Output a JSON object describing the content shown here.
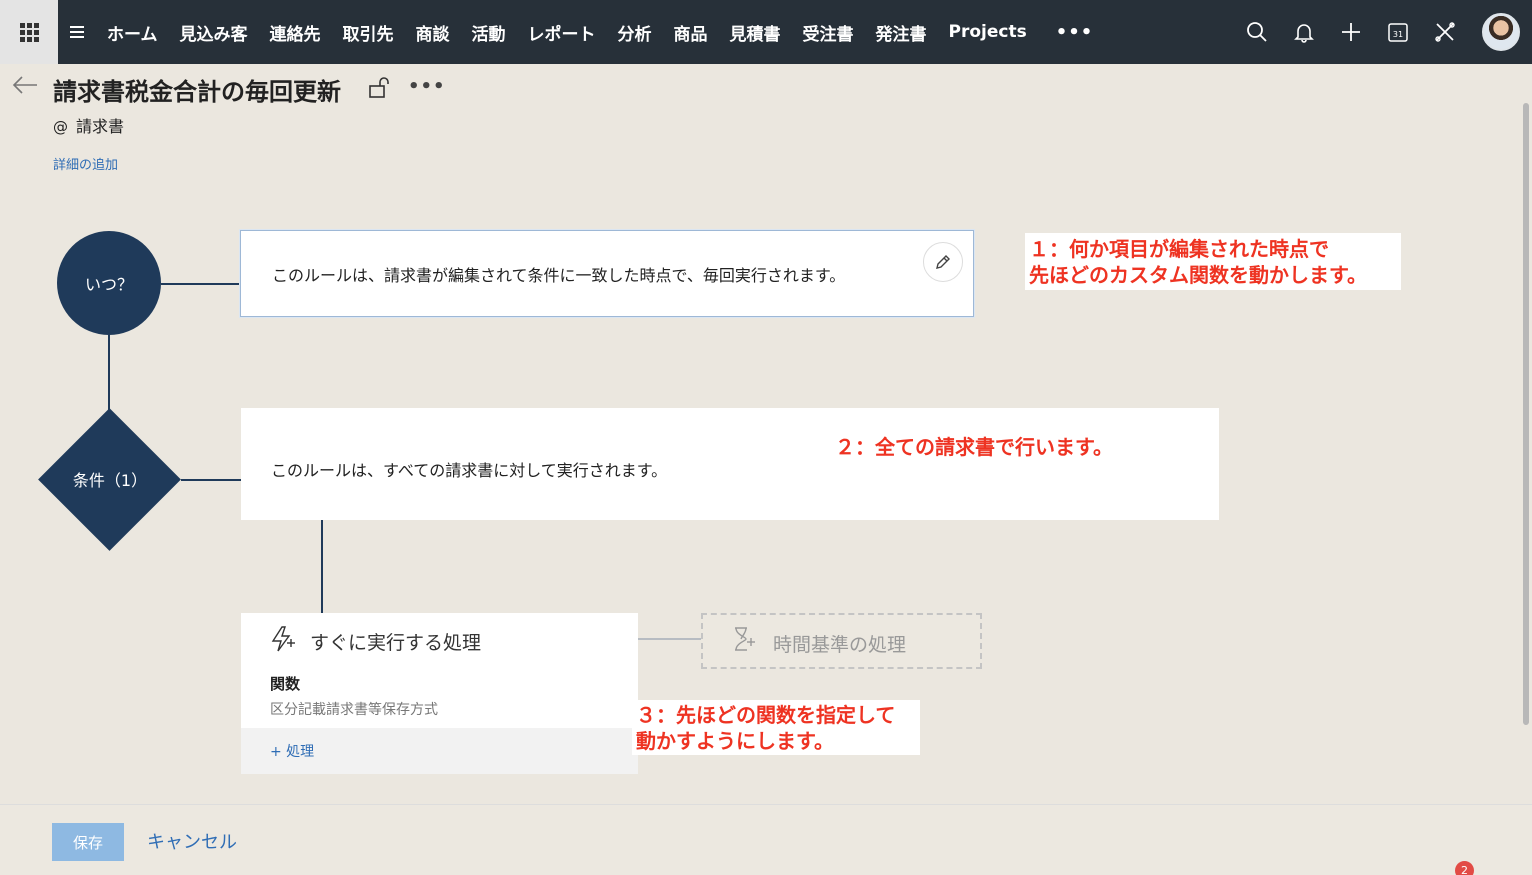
{
  "nav": {
    "items": [
      "ホーム",
      "見込み客",
      "連絡先",
      "取引先",
      "商談",
      "活動",
      "レポート",
      "分析",
      "商品",
      "見積書",
      "受注書",
      "発注書",
      "Projects"
    ],
    "more": "•••",
    "calendar_day": "31"
  },
  "header": {
    "title": "請求書税金合計の毎回更新",
    "more": "•••",
    "module_at": "@",
    "module": "請求書",
    "add_details": "詳細の追加"
  },
  "flow": {
    "when_label": "いつ？",
    "when_text": "このルールは、請求書が編集されて条件に一致した時点で、毎回実行されます。",
    "condition_label": "条件（1）",
    "condition_text": "このルールは、すべての請求書に対して実行されます。",
    "instant_action": {
      "title": "すぐに実行する処理",
      "function_label": "関数",
      "function_name": "区分記載請求書等保存方式",
      "add_action": "+ 処理"
    },
    "scheduled_action": {
      "title": "時間基準の処理"
    }
  },
  "annotations": {
    "note1_line1": "１：何か項目が編集された時点で",
    "note1_line2": "先ほどのカスタム関数を動かします。",
    "note2": "２：全ての請求書で行います。",
    "note3_line1": "３：先ほどの関数を指定して",
    "note3_line2": "動かすようにします。"
  },
  "footer": {
    "save": "保存",
    "cancel": "キャンセル",
    "badge_count": "2"
  },
  "colors": {
    "nav_bg": "#273039",
    "node_blue": "#1f3a5a",
    "link_blue": "#2f6db5",
    "annotation_red": "#ee3322",
    "save_button": "#8eb9e2"
  }
}
